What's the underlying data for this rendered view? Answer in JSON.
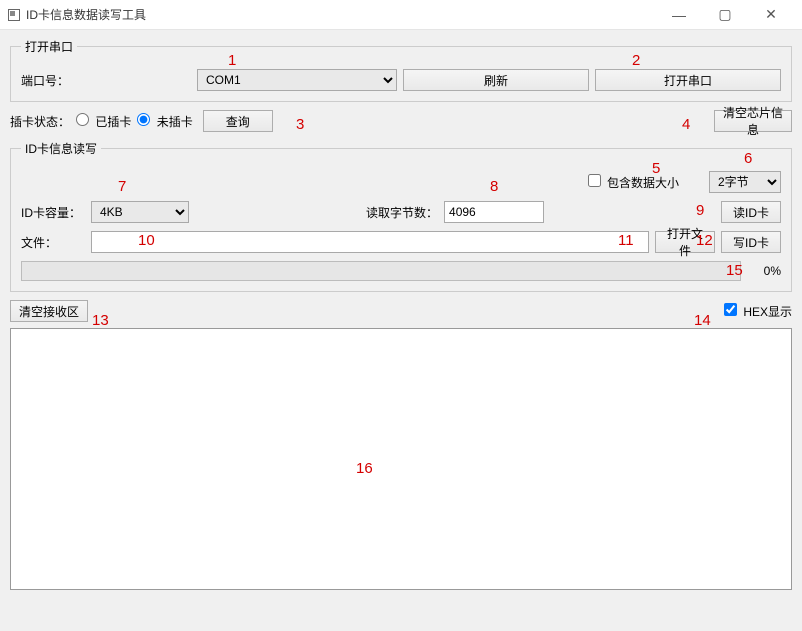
{
  "window": {
    "title": "ID卡信息数据读写工具",
    "min": "—",
    "max": "▢",
    "close": "✕"
  },
  "serial_group": {
    "legend": "打开串口",
    "port_label": "端口号：",
    "port_value": "COM1",
    "refresh_label": "刷新",
    "open_label": "打开串口"
  },
  "card_status": {
    "label": "插卡状态：",
    "opt_inserted": "已插卡",
    "opt_not_inserted": "未插卡",
    "query_label": "查询",
    "clear_chip_label": "清空芯片信息"
  },
  "rw_group": {
    "legend": "ID卡信息读写",
    "include_size_label": "包含数据大小",
    "byte_unit_value": "2字节",
    "capacity_label": "ID卡容量：",
    "capacity_value": "4KB",
    "read_bytes_label": "读取字节数：",
    "read_bytes_value": "4096",
    "read_card_label": "读ID卡",
    "file_label": "文件：",
    "file_value": "",
    "open_file_label": "打开文件",
    "write_card_label": "写ID卡",
    "progress_pct": "0%"
  },
  "receive": {
    "clear_label": "清空接收区",
    "hex_label": "HEX显示",
    "content": ""
  },
  "annotations": {
    "a1": "1",
    "a2": "2",
    "a3": "3",
    "a4": "4",
    "a5": "5",
    "a6": "6",
    "a7": "7",
    "a8": "8",
    "a9": "9",
    "a10": "10",
    "a11": "11",
    "a12": "12",
    "a13": "13",
    "a14": "14",
    "a15": "15",
    "a16": "16"
  }
}
